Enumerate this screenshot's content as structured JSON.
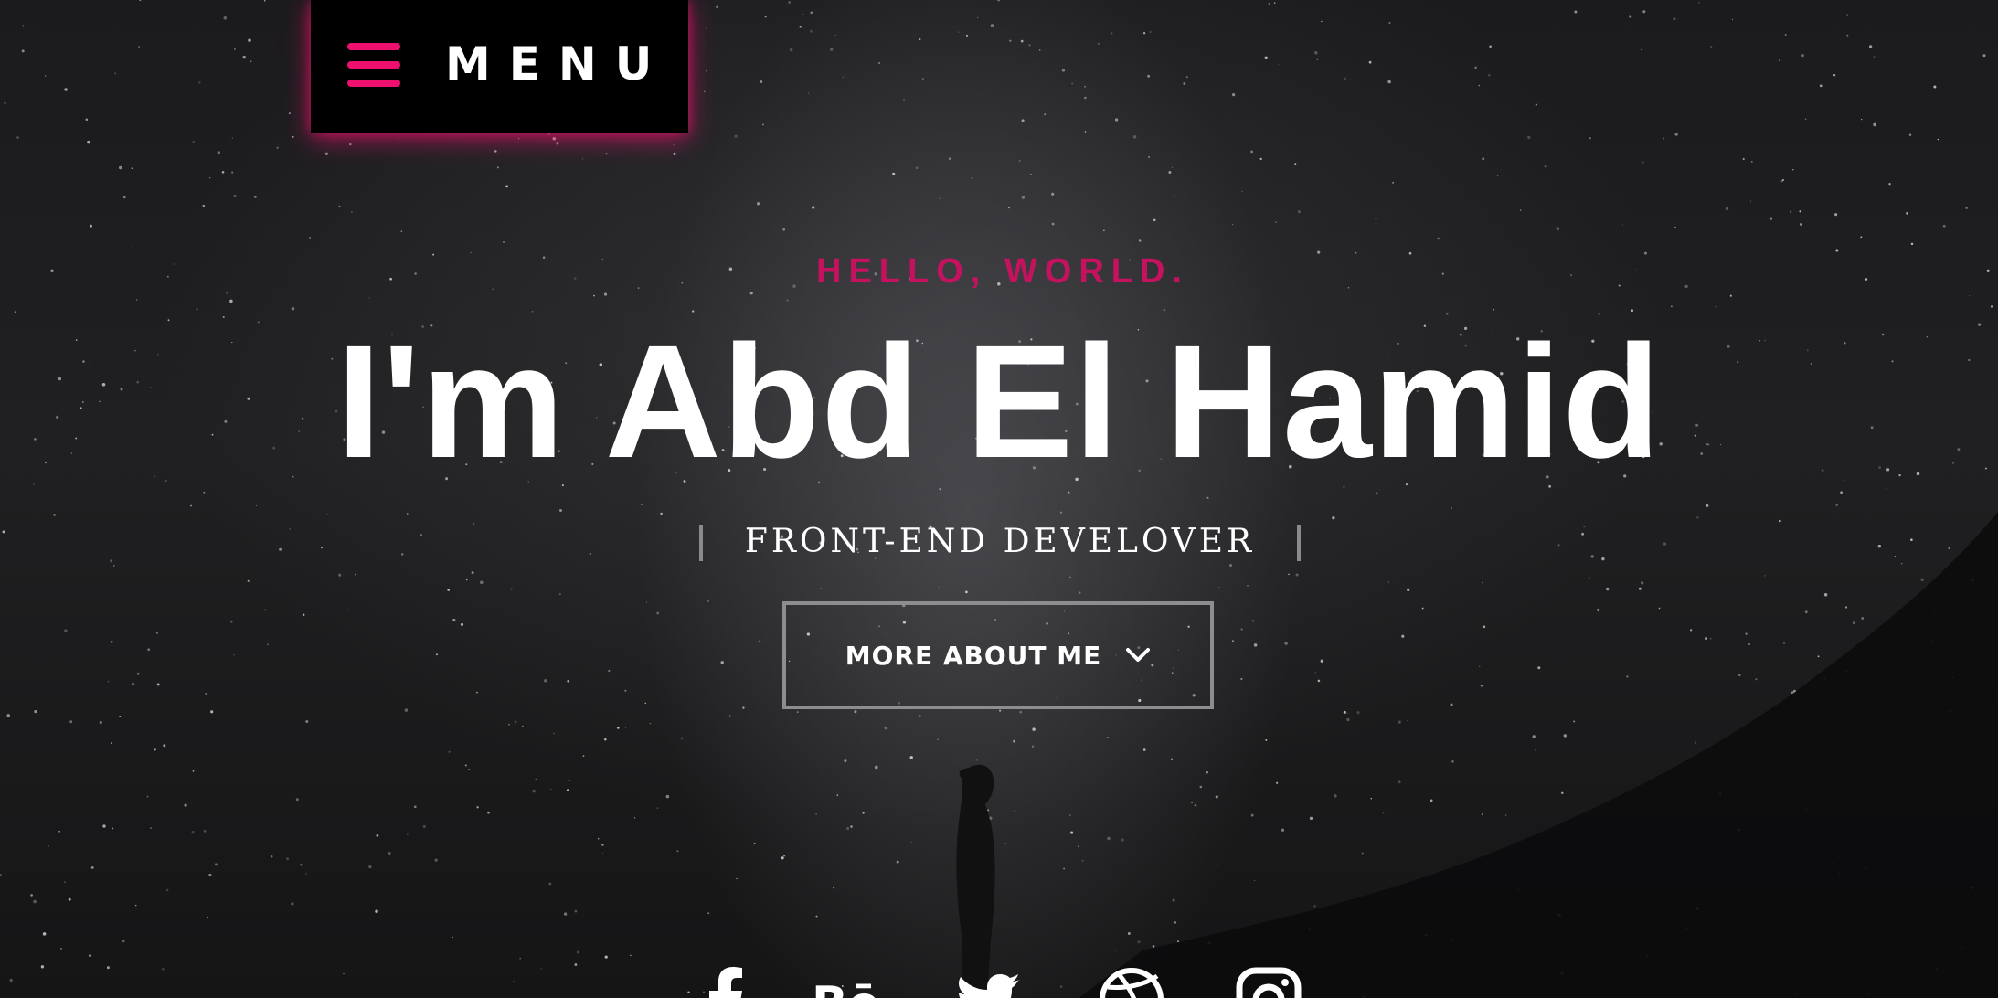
{
  "menu": {
    "label": "MENU"
  },
  "hero": {
    "kicker": "HELLO, WORLD.",
    "headline": "I'm Abd El Hamid",
    "role": "FRONT-END DEVELOVER",
    "cta_label": "MORE ABOUT ME"
  },
  "socials": [
    {
      "name": "facebook-icon"
    },
    {
      "name": "behance-icon"
    },
    {
      "name": "twitter-icon"
    },
    {
      "name": "dribbble-icon"
    },
    {
      "name": "instagram-icon"
    }
  ],
  "colors": {
    "accent": "#ee106e",
    "kicker": "#c4125e",
    "text": "#ffffff",
    "border": "#8d8d8f",
    "background": "#1b1b1d"
  },
  "icons": {
    "menu": "hamburger-icon",
    "cta": "chevron-down-icon"
  }
}
